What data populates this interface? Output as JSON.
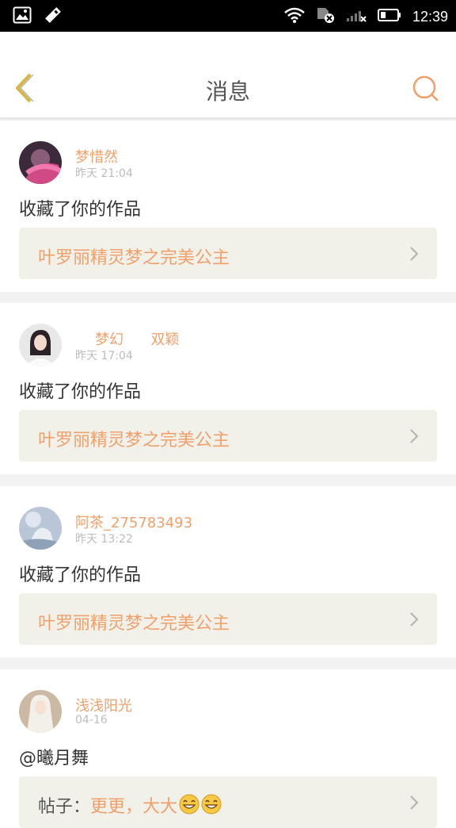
{
  "status_bar": {
    "time": "12:39",
    "icons": [
      "image-icon",
      "usb-debug-icon",
      "wifi-icon",
      "sim-off-icon",
      "signal-icon",
      "battery-icon"
    ]
  },
  "header": {
    "title": "消息",
    "back_icon": "chevron-left-icon",
    "search_icon": "search-icon"
  },
  "colors": {
    "accent": "#f0a06a",
    "back_icon": "#d9b640",
    "link_bg": "#f1f1ea",
    "divider": "#f2f2f2"
  },
  "messages": [
    {
      "user": "梦惜然",
      "time": "昨天 21:04",
      "action": "收藏了你的作品",
      "link": "叶罗丽精灵梦之完美公主"
    },
    {
      "user": "梦幻      双颖",
      "time": "昨天 17:04",
      "action": "收藏了你的作品",
      "link": "叶罗丽精灵梦之完美公主"
    },
    {
      "user": "阿茶_275783493",
      "time": "昨天 13:22",
      "action": "收藏了你的作品",
      "link": "叶罗丽精灵梦之完美公主"
    },
    {
      "user": "浅浅阳光",
      "time": "04-16",
      "action": "@曦月舞",
      "link_prefix": "帖子：",
      "link": "更更，大大",
      "link_emoji": [
        "grinning-emoji",
        "grinning-emoji"
      ]
    }
  ]
}
